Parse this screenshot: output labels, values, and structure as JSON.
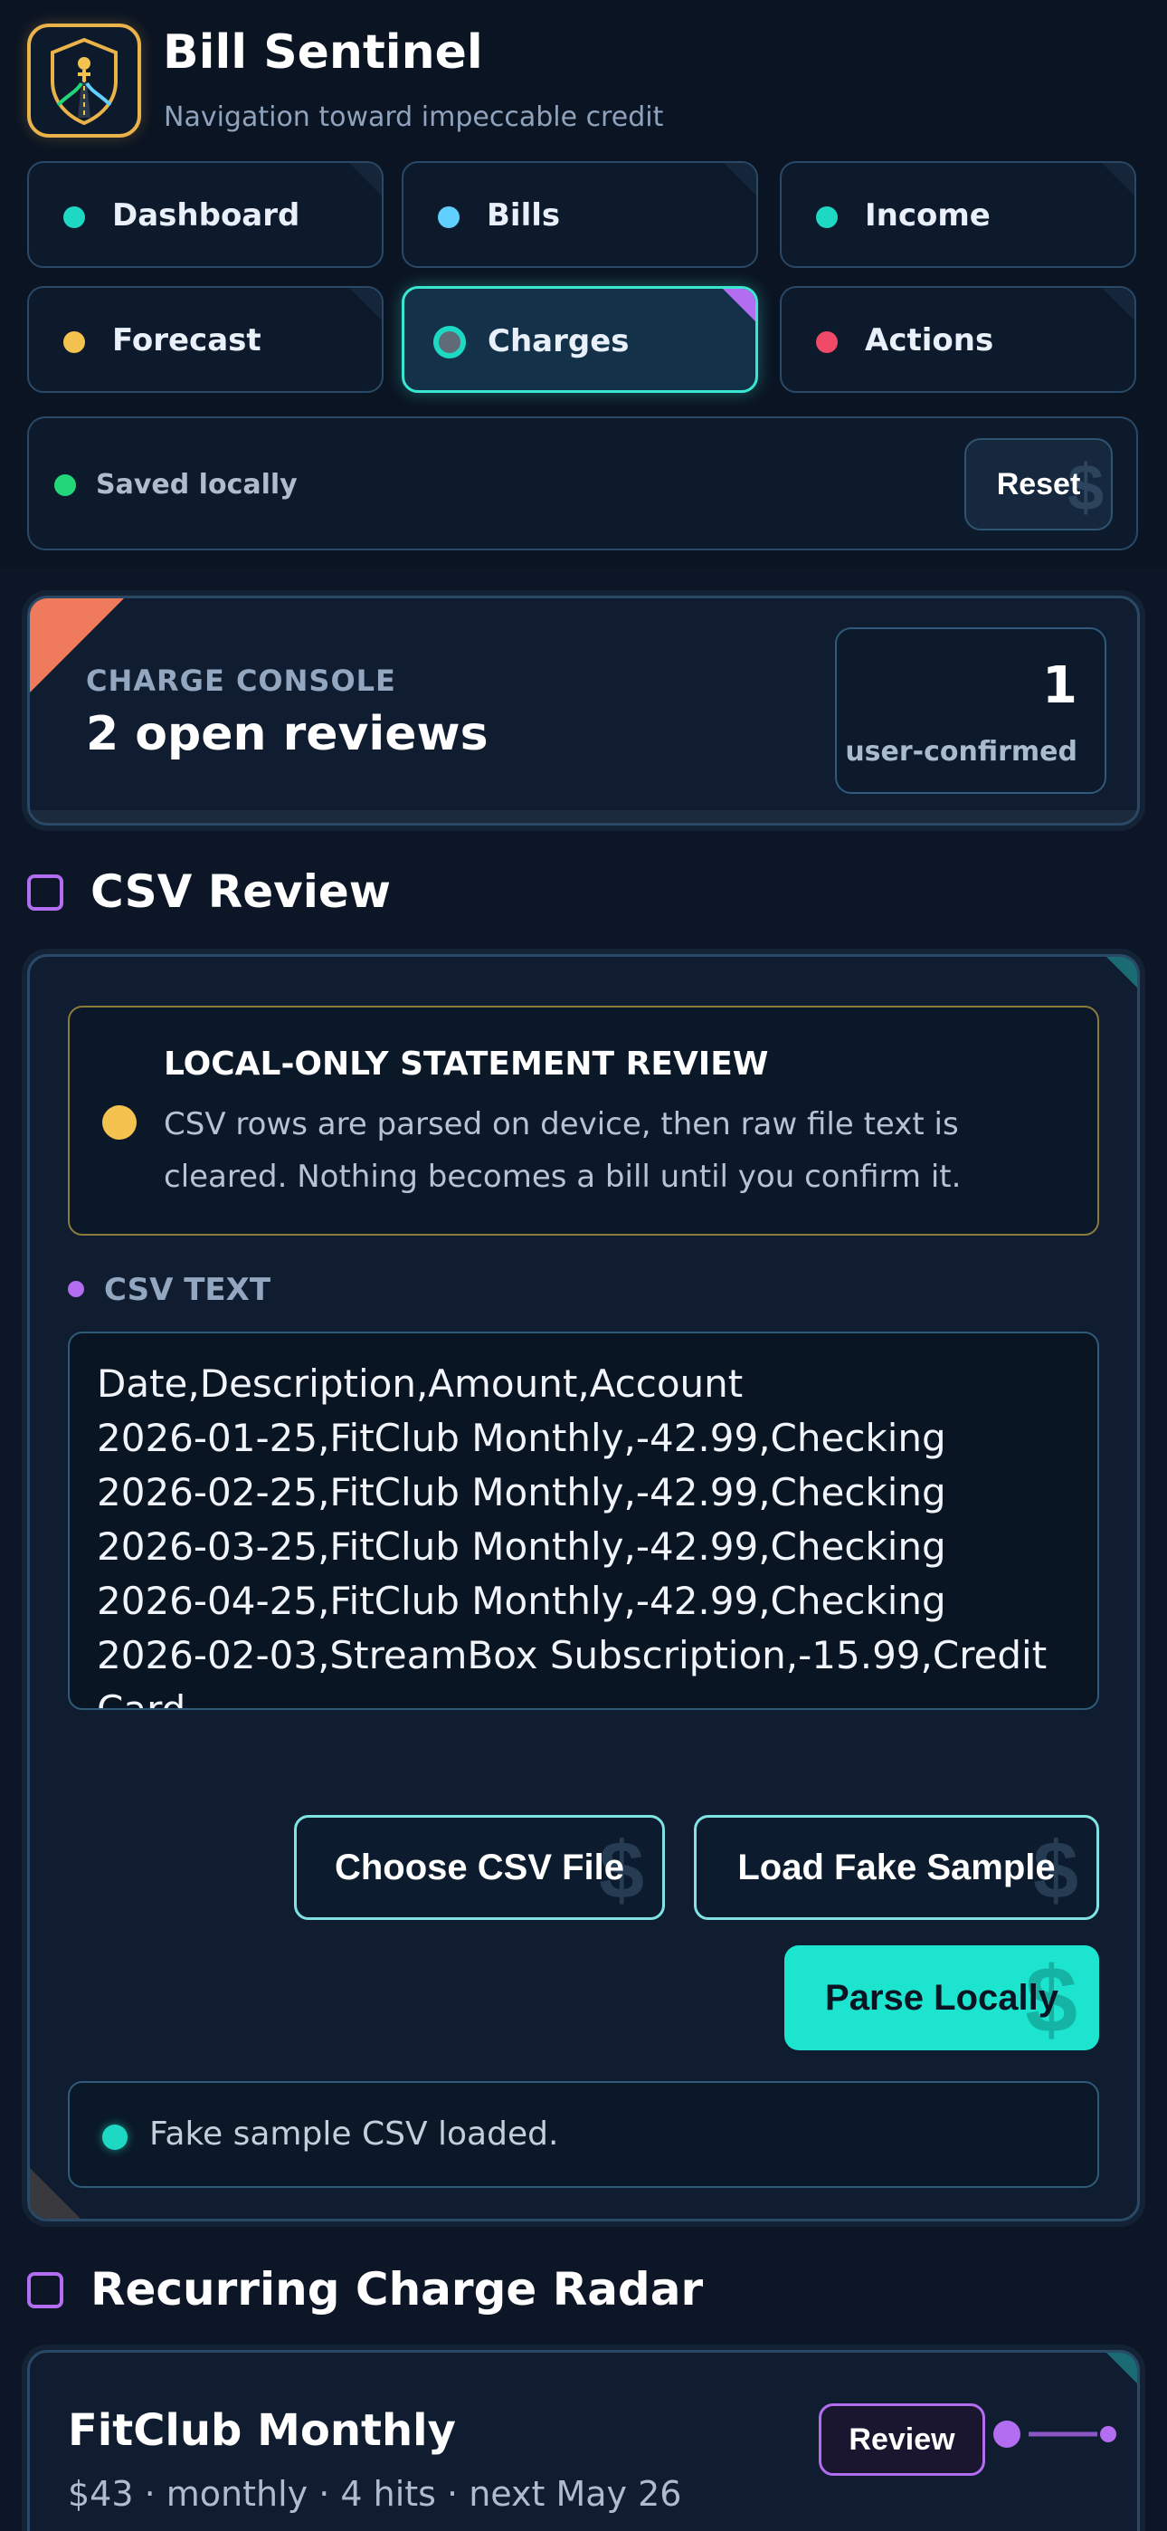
{
  "app": {
    "title": "Bill Sentinel",
    "subtitle": "Navigation toward impeccable credit"
  },
  "nav": {
    "tabs": [
      {
        "label": "Dashboard",
        "dot_color": "#1dd8c2",
        "active": false
      },
      {
        "label": "Bills",
        "dot_color": "#5fd0ff",
        "active": false
      },
      {
        "label": "Income",
        "dot_color": "#1dd8c2",
        "active": false
      },
      {
        "label": "Forecast",
        "dot_color": "#f3c24f",
        "active": false
      },
      {
        "label": "Charges",
        "dot_color": "#1dd8c2",
        "active": true
      },
      {
        "label": "Actions",
        "dot_color": "#f04a68",
        "active": false
      }
    ]
  },
  "status": {
    "text": "Saved locally",
    "reset_label": "Reset"
  },
  "console": {
    "eyebrow": "CHARGE CONSOLE",
    "headline": "2 open reviews",
    "stat_value": "1",
    "stat_caption": "user-confirmed"
  },
  "csv_review": {
    "section_title": "CSV Review",
    "notice_title": "LOCAL-ONLY STATEMENT REVIEW",
    "notice_body": "CSV rows are parsed on device, then raw file text is cleared. Nothing becomes a bill until you confirm it.",
    "csv_label": "CSV TEXT",
    "csv_lines": [
      "Date,Description,Amount,Account",
      "2026-01-25,FitClub Monthly,-42.99,Checking",
      "2026-02-25,FitClub Monthly,-42.99,Checking",
      "2026-03-25,FitClub Monthly,-42.99,Checking",
      "2026-04-25,FitClub Monthly,-42.99,Checking",
      "2026-02-03,StreamBox Subscription,-15.99,Credit",
      "Card"
    ],
    "choose_label": "Choose CSV File",
    "sample_label": "Load Fake Sample",
    "parse_label": "Parse Locally",
    "feedback": "Fake sample CSV loaded."
  },
  "radar": {
    "section_title": "Recurring Charge Radar",
    "item_name": "FitClub Monthly",
    "item_meta": "$43 · monthly · 4 hits · next May 26",
    "review_label": "Review"
  },
  "icons": {
    "logo": "shield-road-logo",
    "button_watermark": "$"
  },
  "colors": {
    "accent": "#1dd8c2",
    "purple": "#b26df0",
    "gold": "#e9b24a",
    "coral": "#f07a5c"
  }
}
